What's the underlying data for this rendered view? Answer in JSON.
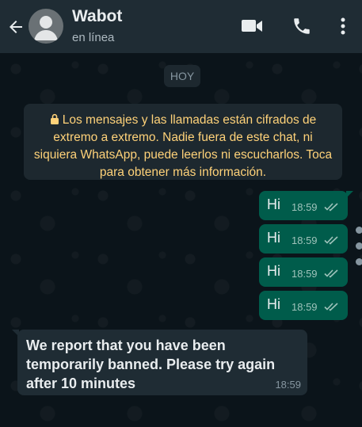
{
  "header": {
    "title": "Wabot",
    "status": "en línea",
    "icons": [
      "back-arrow-icon",
      "video-call-icon",
      "phone-icon",
      "more-vert-icon"
    ]
  },
  "chat": {
    "date_chip": "HOY",
    "encryption_notice": "Los mensajes y las llamadas están cifrados de extremo a extremo. Nadie fuera de este chat, ni siquiera WhatsApp, puede leerlos ni escucharlos. Toca para obtener más información.",
    "outgoing": [
      {
        "text": "Hi",
        "time": "18:59"
      },
      {
        "text": "Hi",
        "time": "18:59"
      },
      {
        "text": "Hi",
        "time": "18:59"
      },
      {
        "text": "Hi",
        "time": "18:59"
      }
    ],
    "incoming": {
      "text": "We report that you have been temporarily banned. Please try again after 10 minutes",
      "time": "18:59"
    }
  },
  "colors": {
    "header_bg": "#1f2c34",
    "chat_bg": "#0b141a",
    "outgoing_bubble": "#005c4b",
    "incoming_bubble": "#1f2c34",
    "notice_text": "#ffd279",
    "read_ticks": "#9fc3bb"
  }
}
